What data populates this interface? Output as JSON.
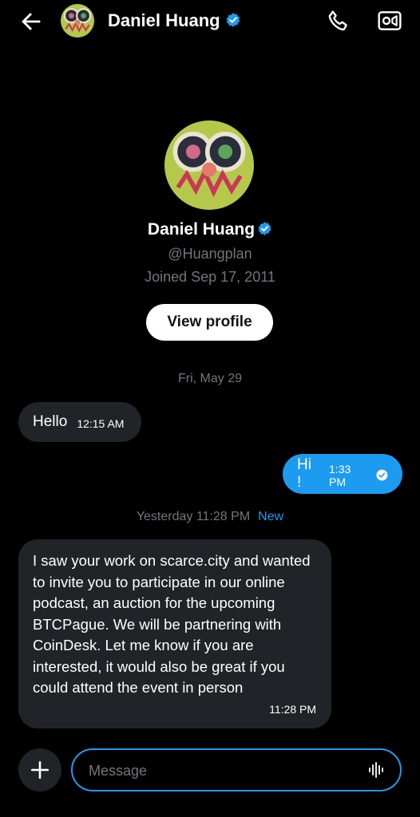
{
  "header": {
    "name": "Daniel Huang",
    "verified": true,
    "icons": [
      "back-arrow-icon",
      "phone-icon",
      "video-icon"
    ]
  },
  "profile": {
    "name": "Daniel Huang",
    "handle": "@Huangplan",
    "joined": "Joined Sep 17, 2011",
    "view_profile_label": "View profile"
  },
  "date_separator": "Fri, May 29",
  "messages": [
    {
      "direction": "incoming",
      "text": "Hello",
      "time": "12:15 AM"
    },
    {
      "direction": "outgoing",
      "text": "Hi !",
      "time": "1:33 PM",
      "status": "read"
    },
    {
      "direction": "incoming",
      "text": "I saw your work on scarce.city and wanted to invite you to participate in our online podcast, an auction for the upcoming BTCPague. We will be partnering with CoinDesk. Let me know if you are interested, it would also be great if you could attend the event in person",
      "time": "11:28 PM"
    }
  ],
  "new_separator": {
    "time": "Yesterday 11:28 PM",
    "label": "New"
  },
  "composer": {
    "placeholder": "Message"
  },
  "colors": {
    "background": "#000000",
    "accent": "#1d9bf0",
    "incoming_bubble": "#202327",
    "muted_text": "#71767b"
  }
}
